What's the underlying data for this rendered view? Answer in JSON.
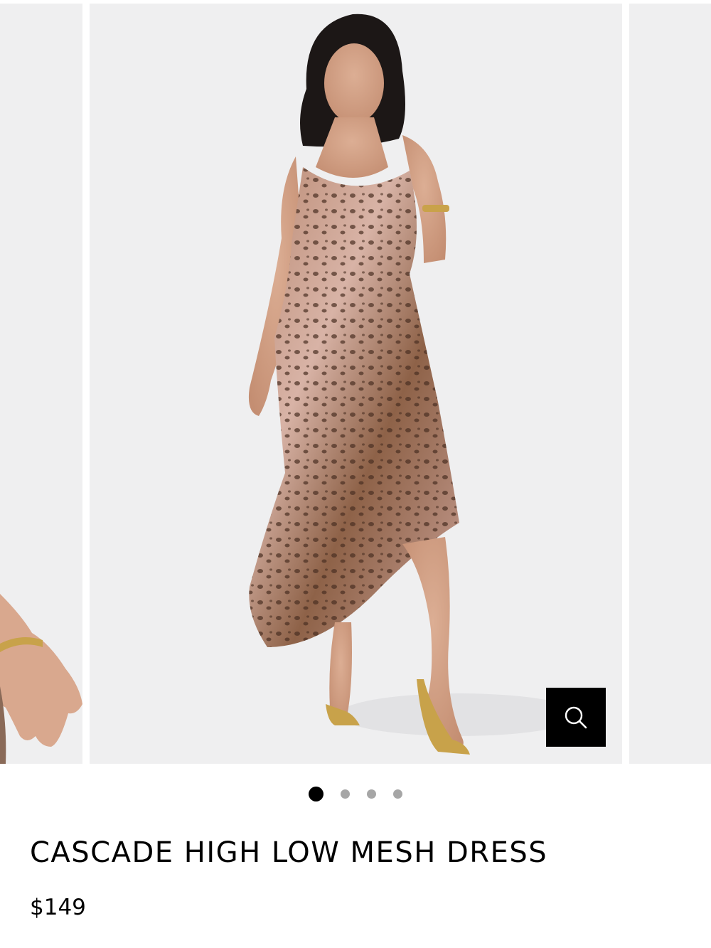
{
  "product": {
    "title": "CASCADE HIGH LOW MESH DRESS",
    "price": "$149",
    "colors": {
      "accent": "#000000",
      "slide_background": "#efeff0",
      "dot_inactive": "#a6a6a6"
    }
  },
  "gallery": {
    "slide_count": 4,
    "active_index": 1,
    "favorite_icon": "heart-outline-icon",
    "zoom_icon": "magnifier-icon"
  }
}
